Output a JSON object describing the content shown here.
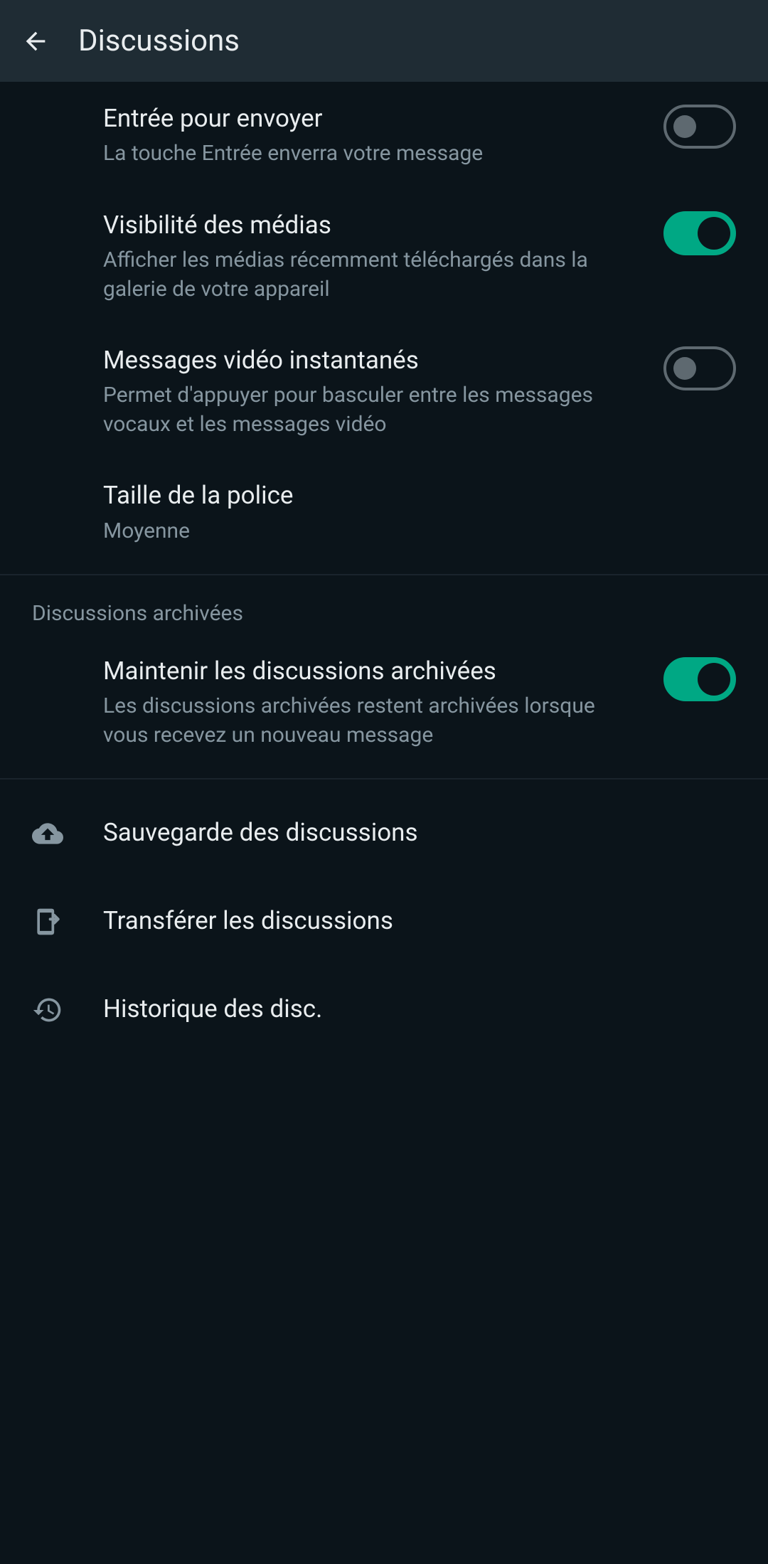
{
  "header": {
    "title": "Discussions"
  },
  "settings": {
    "enterToSend": {
      "title": "Entrée pour envoyer",
      "subtitle": "La touche Entrée enverra votre message"
    },
    "mediaVisibility": {
      "title": "Visibilité des médias",
      "subtitle": "Afficher les médias récemment téléchargés dans la galerie de votre appareil"
    },
    "instantVideo": {
      "title": "Messages vidéo instantanés",
      "subtitle": "Permet d'appuyer pour basculer entre les messages vocaux et les messages vidéo"
    },
    "fontSize": {
      "title": "Taille de la police",
      "subtitle": "Moyenne"
    }
  },
  "archivedSection": {
    "header": "Discussions archivées",
    "keepArchived": {
      "title": "Maintenir les discussions archivées",
      "subtitle": "Les discussions archivées restent archivées lorsque vous recevez un nouveau message"
    }
  },
  "actions": {
    "backup": "Sauvegarde des discussions",
    "transfer": "Transférer les discussions",
    "history": "Historique des disc."
  }
}
